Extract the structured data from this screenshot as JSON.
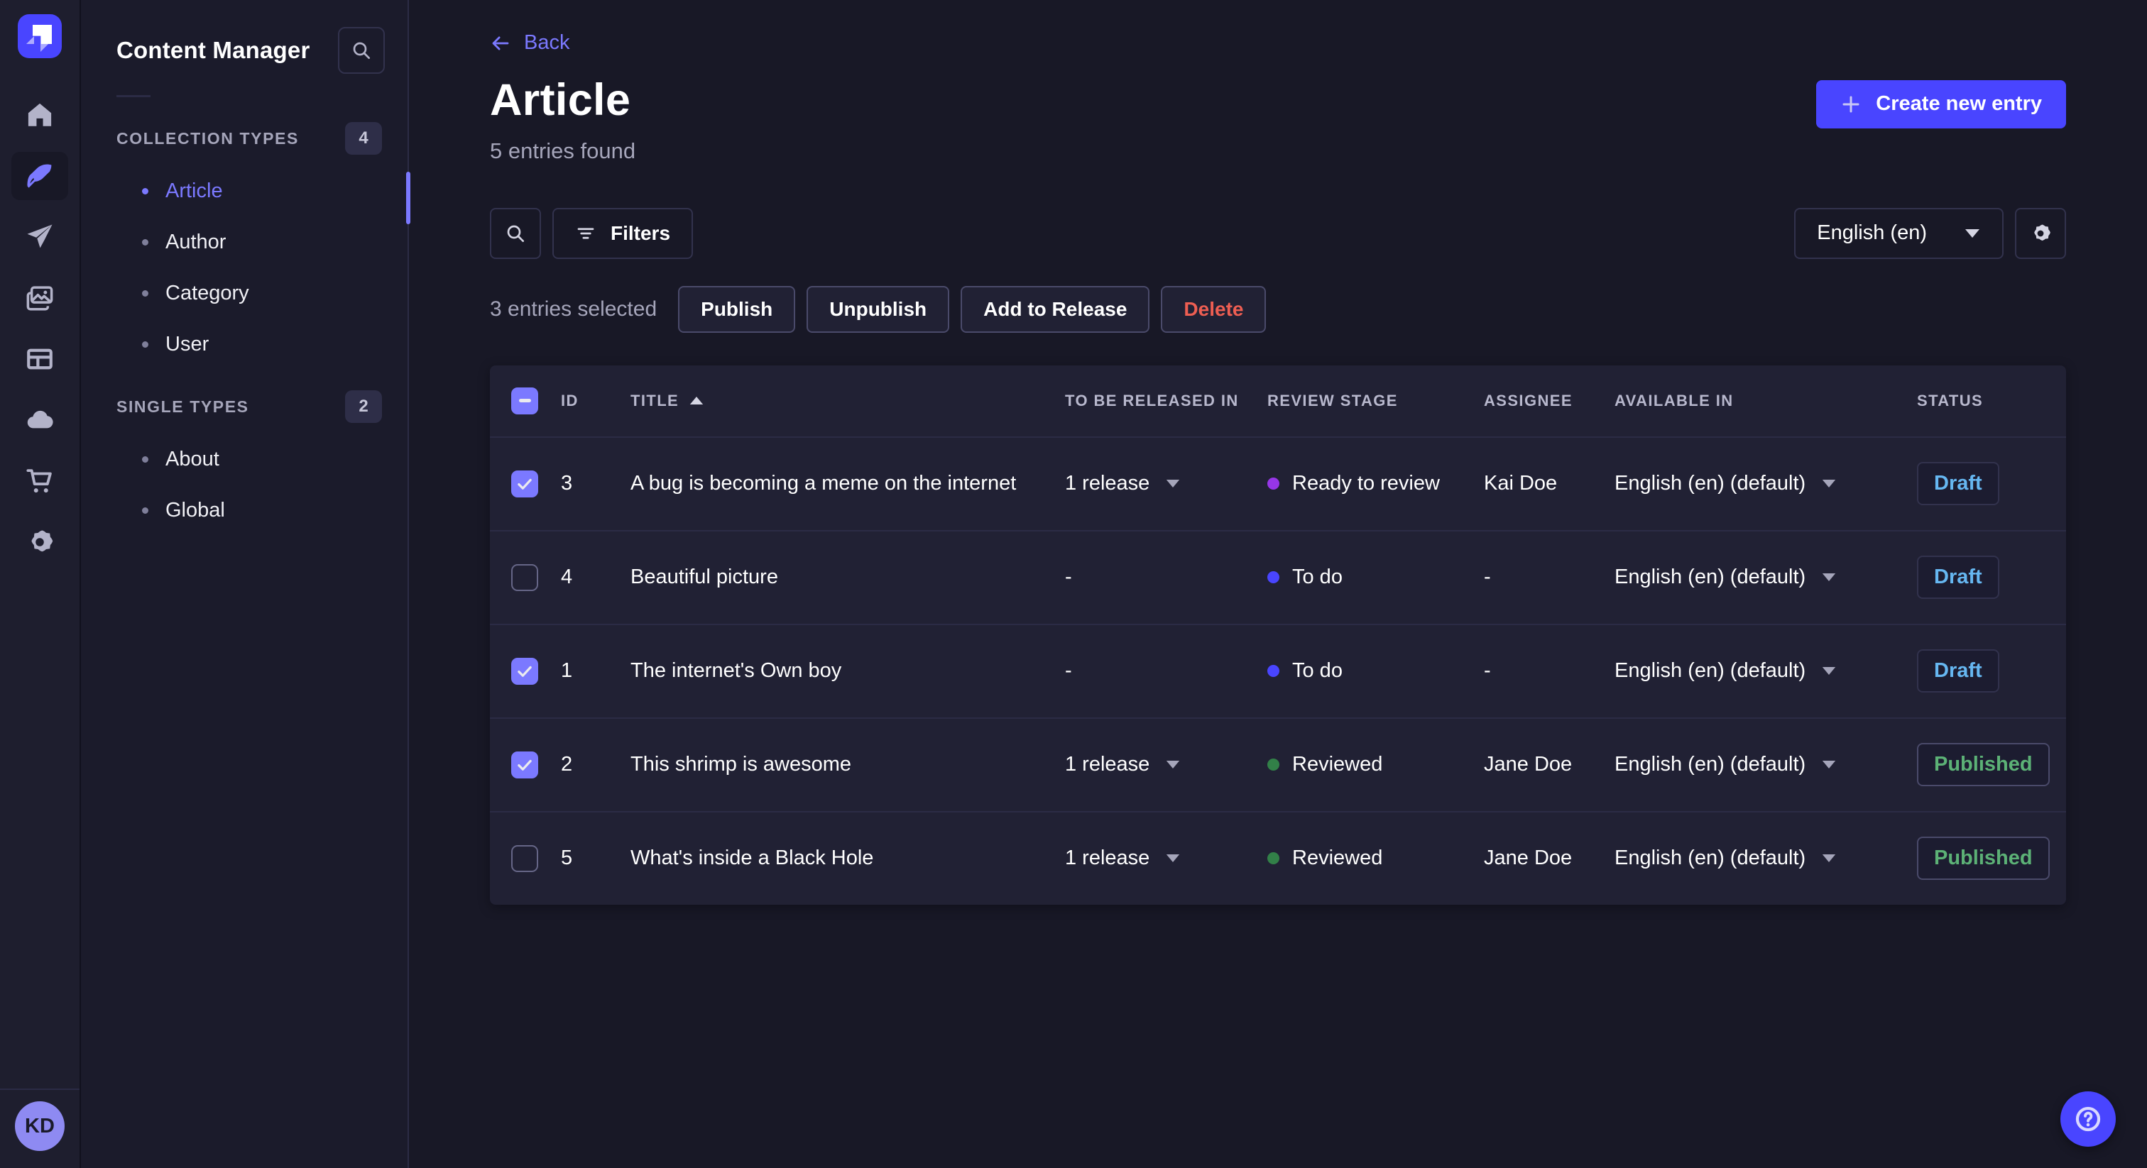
{
  "colors": {
    "primary": "#4945ff",
    "primary_light": "#7b79ff",
    "draft_text": "#66b7f1",
    "published_text": "#5cb176",
    "danger_text": "#ee5e52",
    "stage_todo": "#4945ff",
    "stage_ready_to_review": "#9736e8",
    "stage_reviewed": "#328048"
  },
  "rail": {
    "avatar_initials": "KD",
    "items": [
      {
        "name": "home"
      },
      {
        "name": "content-manager",
        "active": true
      },
      {
        "name": "releases"
      },
      {
        "name": "media-library"
      },
      {
        "name": "content-type-builder"
      },
      {
        "name": "deploy"
      },
      {
        "name": "marketplace"
      },
      {
        "name": "settings"
      }
    ]
  },
  "sidebar": {
    "title": "Content Manager",
    "sections": [
      {
        "label": "COLLECTION TYPES",
        "count": "4",
        "items": [
          {
            "label": "Article",
            "active": true
          },
          {
            "label": "Author"
          },
          {
            "label": "Category"
          },
          {
            "label": "User"
          }
        ]
      },
      {
        "label": "SINGLE TYPES",
        "count": "2",
        "items": [
          {
            "label": "About"
          },
          {
            "label": "Global"
          }
        ]
      }
    ]
  },
  "header": {
    "back": "Back",
    "title": "Article",
    "subtitle": "5 entries found",
    "create_button": "Create new entry"
  },
  "toolbar": {
    "filters": "Filters",
    "locale": "English (en)"
  },
  "bulkbar": {
    "selected": "3 entries selected",
    "publish": "Publish",
    "unpublish": "Unpublish",
    "add_to_release": "Add to Release",
    "delete": "Delete"
  },
  "table": {
    "columns": {
      "id": "ID",
      "title": "TITLE",
      "release": "TO BE RELEASED IN",
      "stage": "REVIEW STAGE",
      "assignee": "ASSIGNEE",
      "available": "AVAILABLE IN",
      "status": "STATUS"
    },
    "sort_column": "title",
    "sort_direction": "asc",
    "header_checkbox_state": "indeterminate",
    "rows": [
      {
        "checked": true,
        "id": "3",
        "title": "A bug is becoming a meme on the internet",
        "release": "1 release",
        "stage": "Ready to review",
        "stage_color": "#9736e8",
        "assignee": "Kai Doe",
        "available": "English (en) (default)",
        "status": "Draft"
      },
      {
        "checked": false,
        "id": "4",
        "title": "Beautiful picture",
        "release": "-",
        "stage": "To do",
        "stage_color": "#4945ff",
        "assignee": "-",
        "available": "English (en) (default)",
        "status": "Draft"
      },
      {
        "checked": true,
        "id": "1",
        "title": "The internet's Own boy",
        "release": "-",
        "stage": "To do",
        "stage_color": "#4945ff",
        "assignee": "-",
        "available": "English (en) (default)",
        "status": "Draft"
      },
      {
        "checked": true,
        "id": "2",
        "title": "This shrimp is awesome",
        "release": "1 release",
        "stage": "Reviewed",
        "stage_color": "#328048",
        "assignee": "Jane Doe",
        "available": "English (en) (default)",
        "status": "Published"
      },
      {
        "checked": false,
        "id": "5",
        "title": "What's inside a Black Hole",
        "release": "1 release",
        "stage": "Reviewed",
        "stage_color": "#328048",
        "assignee": "Jane Doe",
        "available": "English (en) (default)",
        "status": "Published"
      }
    ]
  }
}
